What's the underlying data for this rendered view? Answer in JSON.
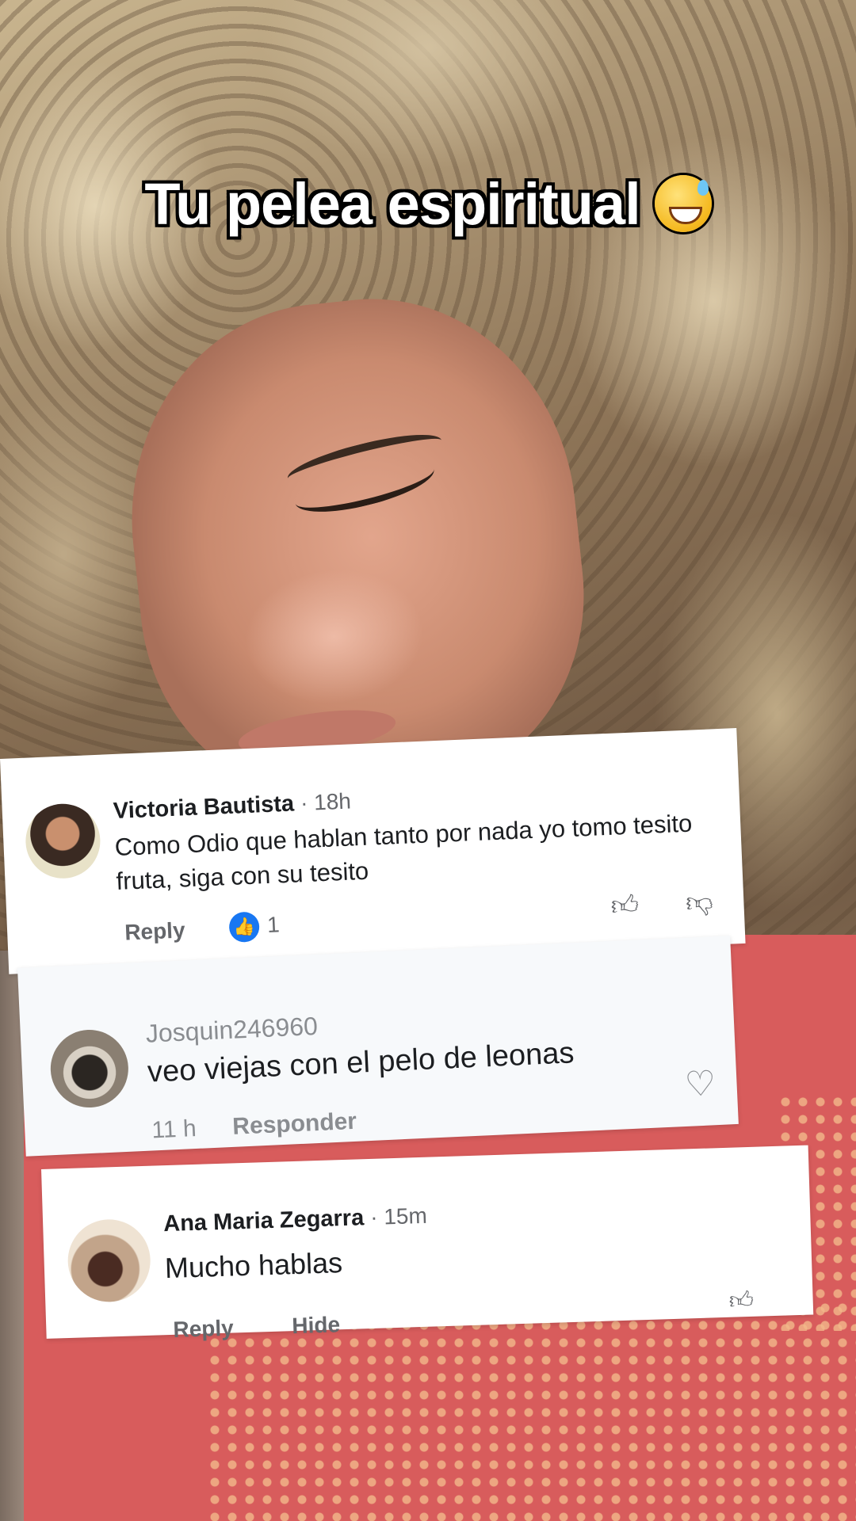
{
  "caption": {
    "text": "Tu pelea espiritual",
    "emoji": "grinning-sweat-icon"
  },
  "comments": [
    {
      "author": "Victoria Bautista",
      "meta": "· 18h",
      "text": "Como Odio que hablan tanto por nada yo tomo tesito fruta, siga con su tesito",
      "reply_label": "Reply",
      "like_count": "1"
    },
    {
      "author": "Josquin246960",
      "text": "veo viejas con el pelo de leonas",
      "time": "11 h",
      "reply_label": "Responder"
    },
    {
      "author": "Ana Maria Zegarra",
      "meta": "· 15m",
      "text": "Mucho hablas",
      "reply_label": "Reply",
      "hide_label": "Hide"
    }
  ],
  "icons": {
    "like_badge": "👍",
    "thumb_up": "👍︎",
    "thumb_down": "👎︎",
    "heart": "♡"
  },
  "colors": {
    "link_blue": "#1877f2",
    "muted": "#65676b",
    "text": "#1c1e21"
  }
}
